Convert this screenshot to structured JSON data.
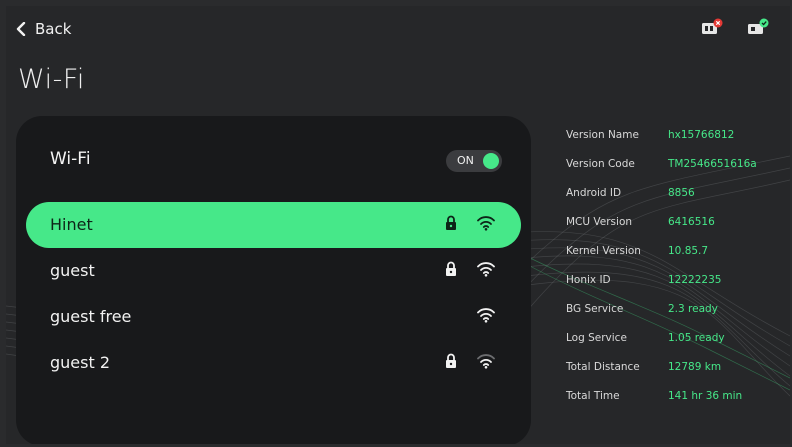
{
  "header": {
    "back_label": "Back",
    "title": "Wi-Fi",
    "status_icons": [
      {
        "name": "card-error-icon",
        "badge": "error",
        "badge_color": "#e53935"
      },
      {
        "name": "card-ok-icon",
        "badge": "ok",
        "badge_color": "#46e889"
      }
    ]
  },
  "wifi": {
    "title": "Wi-Fi",
    "toggle_label": "ON",
    "enabled": true,
    "networks": [
      {
        "name": "Hinet",
        "secured": true,
        "signal": "full",
        "selected": true
      },
      {
        "name": "guest",
        "secured": true,
        "signal": "full",
        "selected": false
      },
      {
        "name": "guest free",
        "secured": false,
        "signal": "full",
        "selected": false
      },
      {
        "name": "guest 2",
        "secured": true,
        "signal": "partial",
        "selected": false
      }
    ]
  },
  "info": [
    {
      "label": "Version Name",
      "value": "hx15766812"
    },
    {
      "label": "Version Code",
      "value": "TM2546651616a"
    },
    {
      "label": "Android ID",
      "value": "8856"
    },
    {
      "label": "MCU Version",
      "value": "6416516"
    },
    {
      "label": "Kernel Version",
      "value": "10.85.7"
    },
    {
      "label": "Honix ID",
      "value": "12222235"
    },
    {
      "label": "BG Service",
      "value": "2.3 ready"
    },
    {
      "label": "Log Service",
      "value": "1.05 ready"
    },
    {
      "label": "Total Distance",
      "value": "12789 km"
    },
    {
      "label": "Total Time",
      "value": "141 hr 36 min"
    }
  ],
  "colors": {
    "accent": "#46e889",
    "background": "#262729",
    "panel": "#18191b",
    "error": "#e53935"
  }
}
